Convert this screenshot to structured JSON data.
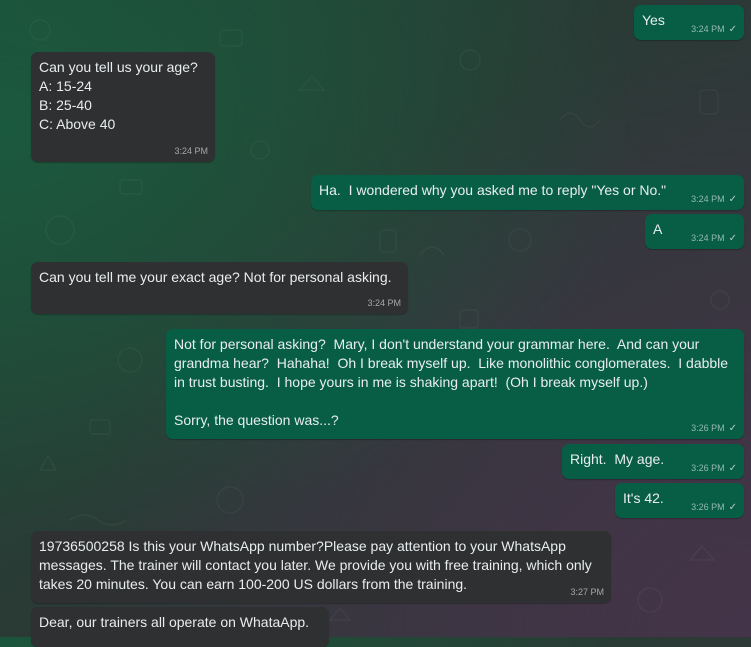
{
  "messages": [
    {
      "side": "out",
      "text": "Yes",
      "time": "3:24 PM",
      "check": "✓"
    },
    {
      "side": "in",
      "text": "Can you tell us your age?\nA: 15-24\nB: 25-40\nC: Above 40",
      "time": "3:24 PM"
    },
    {
      "side": "out",
      "text": "Ha.  I wondered why you asked me to reply \"Yes or No.\"",
      "time": "3:24 PM",
      "check": "✓"
    },
    {
      "side": "out",
      "text": "A",
      "time": "3:24 PM",
      "check": "✓"
    },
    {
      "side": "in",
      "text": "Can you tell me your exact age? Not for personal asking.",
      "time": "3:24 PM"
    },
    {
      "side": "out",
      "text": "Not for personal asking?  Mary, I don't understand your grammar here.  And can your grandma hear?  Hahaha!  Oh I break myself up.  Like monolithic conglomerates.  I dabble in trust busting.  I hope yours in me is shaking apart!  (Oh I break myself up.)\n\nSorry, the question was...?",
      "time": "3:26 PM",
      "check": "✓"
    },
    {
      "side": "out",
      "text": "Right.  My age.",
      "time": "3:26 PM",
      "check": "✓"
    },
    {
      "side": "out",
      "text": "It's 42.",
      "time": "3:26 PM",
      "check": "✓"
    },
    {
      "side": "in",
      "text": "19736500258 Is this your WhatsApp number?Please pay attention to your WhatsApp messages. The trainer will contact you later. We provide you with free training, which only takes 20 minutes. You can earn 100-200 US dollars from the training.",
      "time": "3:27 PM"
    },
    {
      "side": "in",
      "text": "Dear, our trainers all operate on WhataApp.",
      "time": ""
    }
  ]
}
